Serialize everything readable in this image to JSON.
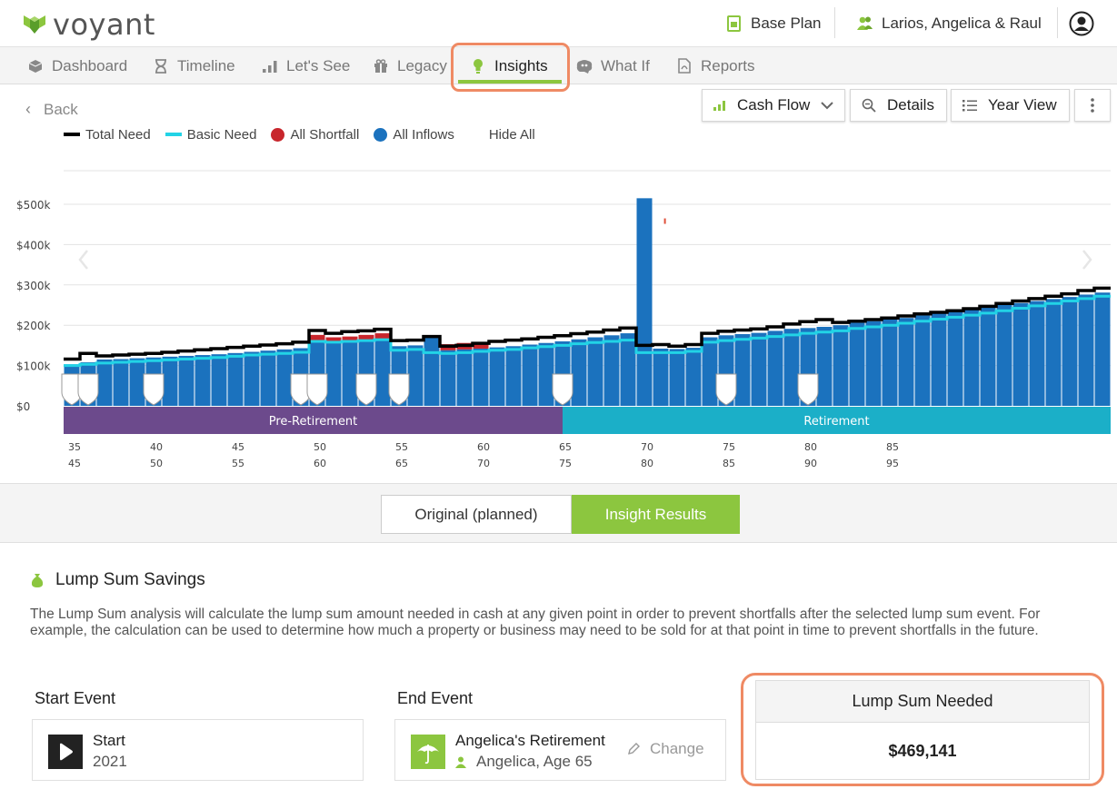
{
  "app": {
    "brand": "voyant",
    "brand_color": "#8cc63f",
    "highlight_color": "#ef8a64"
  },
  "header": {
    "plan": "Base Plan",
    "client": "Larios, Angelica & Raul"
  },
  "nav": {
    "items": [
      {
        "label": "Dashboard",
        "icon": "cube-icon"
      },
      {
        "label": "Timeline",
        "icon": "hourglass-icon"
      },
      {
        "label": "Let's See",
        "icon": "bar-chart-icon"
      },
      {
        "label": "Legacy",
        "icon": "gift-icon"
      },
      {
        "label": "Insights",
        "icon": "lightbulb-icon",
        "active": true
      },
      {
        "label": "What If",
        "icon": "brain-icon"
      },
      {
        "label": "Reports",
        "icon": "pdf-icon"
      }
    ]
  },
  "controls": {
    "back": "Back",
    "view": "Cash Flow",
    "details": "Details",
    "year_view": "Year View"
  },
  "legend": {
    "total_need": "Total Need",
    "basic_need": "Basic Need",
    "shortfall": "All Shortfall",
    "inflows": "All Inflows",
    "hide_all": "Hide All"
  },
  "chart_data": {
    "type": "bar",
    "x_label_rows": [
      "age-primary",
      "age-secondary"
    ],
    "x_ticks_primary": [
      "35",
      "40",
      "45",
      "50",
      "55",
      "60",
      "65",
      "70",
      "75",
      "80",
      "85"
    ],
    "x_ticks_secondary": [
      "45",
      "50",
      "55",
      "60",
      "65",
      "70",
      "75",
      "80",
      "85",
      "90",
      "95"
    ],
    "y_ticks": [
      "$0",
      "$100k",
      "$200k",
      "$300k",
      "$400k",
      "$500k"
    ],
    "ylim": [
      0,
      500000
    ],
    "ages": [
      35,
      36,
      37,
      38,
      39,
      40,
      41,
      42,
      43,
      44,
      45,
      46,
      47,
      48,
      49,
      50,
      51,
      52,
      53,
      54,
      55,
      56,
      57,
      58,
      59,
      60,
      61,
      62,
      63,
      64,
      65,
      66,
      67,
      68,
      69,
      70,
      71,
      72,
      73,
      74,
      75,
      76,
      77,
      78,
      79,
      80,
      81,
      82,
      83,
      84,
      85,
      86,
      87,
      88,
      89,
      90
    ],
    "series": [
      {
        "name": "All Inflows",
        "color": "#1b72be",
        "values": [
          103000,
          108000,
          115000,
          116000,
          118000,
          120000,
          122000,
          124000,
          126000,
          128000,
          131000,
          134000,
          137000,
          140000,
          143000,
          162000,
          158000,
          160000,
          164000,
          166000,
          148000,
          150000,
          170000,
          138000,
          140000,
          142000,
          145000,
          148000,
          152000,
          156000,
          160000,
          165000,
          170000,
          175000,
          180000,
          515000,
          142000,
          141000,
          144000,
          170000,
          175000,
          178000,
          181000,
          186000,
          191000,
          193000,
          196000,
          200000,
          206000,
          210000,
          214000,
          218000,
          224000,
          230000,
          236000,
          240000,
          245000,
          250000,
          255000,
          260000,
          265000,
          270000,
          276000,
          281000
        ]
      },
      {
        "name": "All Shortfall",
        "color": "#c8262c",
        "values": [
          0,
          0,
          0,
          0,
          0,
          0,
          0,
          0,
          0,
          0,
          0,
          0,
          0,
          0,
          0,
          14000,
          12000,
          12000,
          12000,
          14000,
          0,
          0,
          0,
          15000,
          16000,
          15000,
          0,
          0,
          0,
          0,
          0,
          0,
          0,
          0,
          0,
          0,
          0,
          0,
          0,
          0,
          0,
          0,
          0,
          0,
          0,
          0,
          0,
          0,
          0,
          0,
          0,
          0,
          0,
          0,
          0,
          0,
          0,
          0,
          0,
          0,
          0,
          0,
          0,
          0
        ]
      },
      {
        "name": "Total Need",
        "color": "#000000",
        "values": [
          116000,
          130000,
          124000,
          126000,
          128000,
          130000,
          133000,
          136000,
          139000,
          142000,
          145000,
          148000,
          151000,
          154000,
          158000,
          187000,
          180000,
          184000,
          186000,
          190000,
          162000,
          163000,
          172000,
          148000,
          150000,
          155000,
          160000,
          163000,
          166000,
          170000,
          174000,
          179000,
          183000,
          188000,
          193000,
          150000,
          152000,
          148000,
          152000,
          180000,
          185000,
          188000,
          191000,
          196000,
          203000,
          209000,
          214000,
          207000,
          210000,
          214000,
          218000,
          223000,
          228000,
          232000,
          236000,
          241000,
          247000,
          254000,
          260000,
          266000,
          272000,
          278000,
          286000,
          292000
        ]
      },
      {
        "name": "Basic Need",
        "color": "#22d3e6",
        "values": [
          100000,
          103000,
          106000,
          108000,
          110000,
          112000,
          114000,
          116000,
          118000,
          120000,
          123000,
          126000,
          128000,
          130000,
          133000,
          160000,
          158000,
          160000,
          162000,
          164000,
          138000,
          140000,
          132000,
          130000,
          132000,
          135000,
          138000,
          140000,
          144000,
          147000,
          150000,
          154000,
          157000,
          160000,
          163000,
          132000,
          132000,
          132000,
          135000,
          158000,
          162000,
          165000,
          168000,
          172000,
          176000,
          180000,
          183000,
          186000,
          192000,
          196000,
          200000,
          205000,
          210000,
          215000,
          220000,
          225000,
          230000,
          236000,
          242000,
          248000,
          254000,
          260000,
          266000,
          272000
        ]
      }
    ],
    "phases": [
      {
        "label": "Pre-Retirement",
        "color": "#6c4a8c"
      },
      {
        "label": "Retirement",
        "color": "#1bafc8"
      }
    ],
    "event_markers_age": [
      35,
      36,
      40,
      49,
      50,
      53,
      55,
      65,
      75,
      80
    ]
  },
  "toggle": {
    "original": "Original (planned)",
    "results": "Insight Results"
  },
  "insight": {
    "title": "Lump Sum Savings",
    "description": "The Lump Sum analysis will calculate the lump sum amount needed in cash at any given point in order to prevent shortfalls after the selected lump sum event. For example, the calculation can be used to determine how much a property or business may need to be sold for at that point in time to prevent shortfalls in the future.",
    "start_event_label": "Start Event",
    "start_event_name": "Start",
    "start_event_year": "2021",
    "end_event_label": "End Event",
    "end_event_name": "Angelica's Retirement",
    "end_event_person": "Angelica, Age 65",
    "change": "Change",
    "lump_sum_label": "Lump Sum Needed",
    "lump_sum_value": "$469,141"
  }
}
